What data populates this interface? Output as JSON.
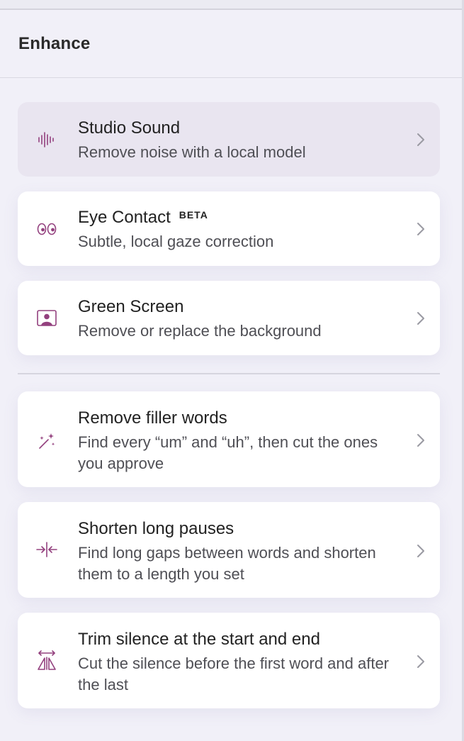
{
  "header": {
    "title": "Enhance"
  },
  "items": [
    {
      "icon": "waveform-icon",
      "title": "Studio Sound",
      "badge": "",
      "desc": "Remove noise with a local model"
    },
    {
      "icon": "eyes-icon",
      "title": "Eye Contact",
      "badge": "BETA",
      "desc": "Subtle, local gaze correction"
    },
    {
      "icon": "person-portrait-icon",
      "title": "Green Screen",
      "badge": "",
      "desc": "Remove or replace the background"
    },
    {
      "icon": "magic-wand-icon",
      "title": "Remove filler words",
      "badge": "",
      "desc": "Find every “um” and “uh”, then cut the ones you approve"
    },
    {
      "icon": "compress-arrows-icon",
      "title": "Shorten long pauses",
      "badge": "",
      "desc": "Find long gaps between words and shorten them to a length you set"
    },
    {
      "icon": "trim-icon",
      "title": "Trim silence at the start and end",
      "badge": "",
      "desc": "Cut the silence before the first word and after the last"
    }
  ],
  "colors": {
    "accent": "#93407e",
    "background": "#f1f0f8",
    "card": "#ffffff",
    "active_card": "#e9e5f0"
  }
}
